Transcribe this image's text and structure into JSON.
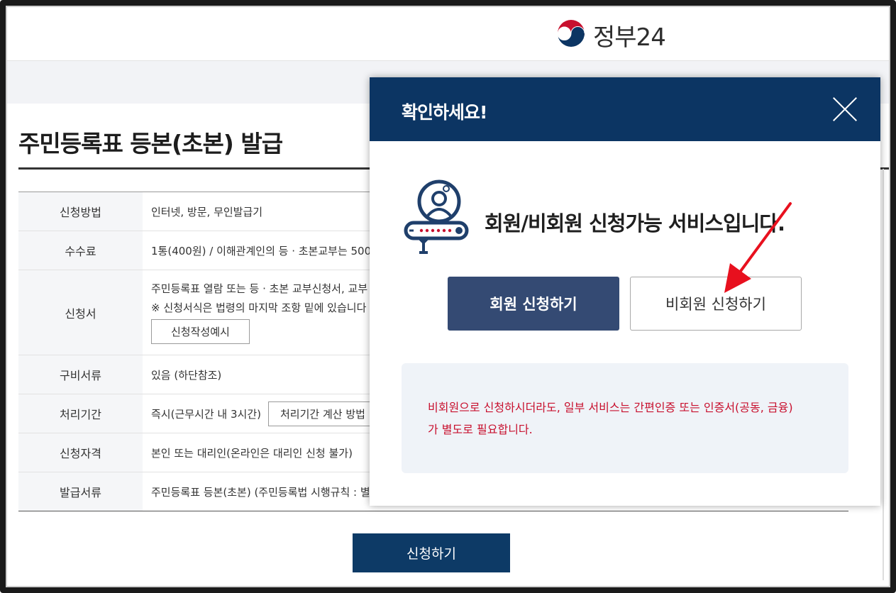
{
  "header": {
    "logo_text": "정부24",
    "logo_icon": "taegeuk-emblem-icon"
  },
  "page": {
    "title": "주민등록표 등본(초본) 발급",
    "apply_button": "신청하기"
  },
  "table": {
    "rows": [
      {
        "label": "신청방법",
        "value": "인터넷, 방문, 무인발급기"
      },
      {
        "label": "수수료",
        "value": "1통(400원) / 이해관계인의 등 · 초본교부는 500"
      },
      {
        "label": "신청서",
        "value": "주민등록표 열람 또는 등 · 초본 교부신청서, 교부",
        "note": "※ 신청서식은 법령의 마지막 조항 밑에 있습니다",
        "button": "신청작성예시"
      },
      {
        "label": "구비서류",
        "value": "있음 (하단참조)"
      },
      {
        "label": "처리기간",
        "value": "즉시(근무시간 내 3시간)",
        "button": "처리기간 계산 방법"
      },
      {
        "label": "신청자격",
        "value": "본인 또는 대리인(온라인은 대리인 신청 불가)"
      },
      {
        "label": "발급서류",
        "value": "주민등록표 등본(초본) (주민등록법 시행규칙 : 별"
      }
    ]
  },
  "modal": {
    "title": "확인하세요!",
    "close_icon": "close-icon",
    "icon": "member-login-icon",
    "message": "회원/비회원 신청가능 서비스입니다.",
    "member_button": "회원 신청하기",
    "guest_button": "비회원 신청하기",
    "notice_line1": "비회원으로 신청하시더라도, 일부 서비스는 간편인증 또는 인증서(공동, 금융)",
    "notice_line2": "가 별도로 필요합니다."
  },
  "colors": {
    "brand_navy": "#0c3563",
    "member_button": "#344a73",
    "notice_text": "#c8102e",
    "arrow": "#e8101e"
  }
}
